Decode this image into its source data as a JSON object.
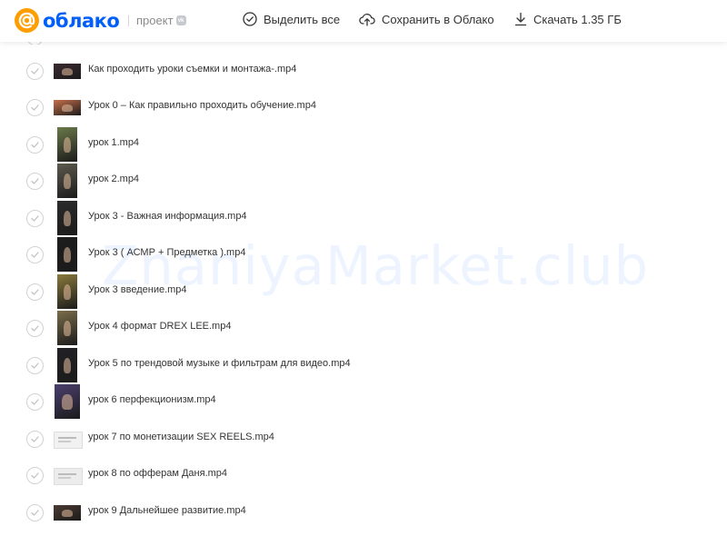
{
  "header": {
    "logo_text": "облако",
    "project_label": "проект",
    "vk_badge": "vk",
    "select_all": "Выделить все",
    "save_to_cloud": "Сохранить в Облако",
    "download": "Скачать 1.35 ГБ"
  },
  "files": [
    {
      "name": "Как проходить уроки съемки и монтажа-.mp4",
      "thumb": "wide",
      "color": "#3a2a30"
    },
    {
      "name": "Урок 0 – Как правильно проходить обучение.mp4",
      "thumb": "wide",
      "color": "#c6704a"
    },
    {
      "name": "урок 1.mp4",
      "thumb": "tall",
      "color": "#6b7a4a"
    },
    {
      "name": "урок 2.mp4",
      "thumb": "tall",
      "color": "#5c5a4e"
    },
    {
      "name": "Урок 3 - Важная информация.mp4",
      "thumb": "tall",
      "color": "#2b2b2b"
    },
    {
      "name": "Урок 3 ( АСМР + Предметка ).mp4",
      "thumb": "tall",
      "color": "#1d1d1d"
    },
    {
      "name": "Урок 3 введение.mp4",
      "thumb": "tall",
      "color": "#8a7a3c"
    },
    {
      "name": "Урок 4 формат DREX LEE.mp4",
      "thumb": "tall",
      "color": "#7b6d4a"
    },
    {
      "name": "Урок 5 по трендовой музыке и фильтрам для видео.mp4",
      "thumb": "tall",
      "color": "#222226"
    },
    {
      "name": "урок 6 перфекционизм.mp4",
      "thumb": "tallwide",
      "color": "#4a3f6e"
    },
    {
      "name": "урок 7 по монетизации SEX REELS.mp4",
      "thumb": "doc",
      "color": "#f1f1f1"
    },
    {
      "name": "урок 8 по офферам Даня.mp4",
      "thumb": "doc",
      "color": "#ececec"
    },
    {
      "name": "урок 9 Дальнейшее развитие.mp4",
      "thumb": "wide",
      "color": "#4b3a32"
    }
  ],
  "watermark": "ZnaniyaMarket.club",
  "colors": {
    "brand_blue": "#005ff9",
    "brand_orange": "#ff9e00"
  }
}
